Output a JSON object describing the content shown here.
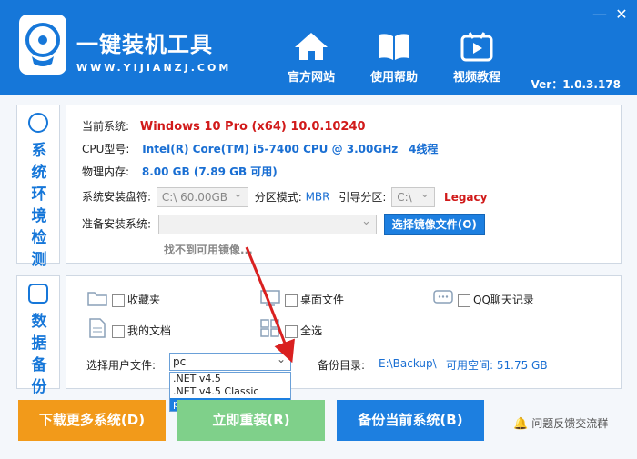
{
  "app": {
    "title": "一键装机工具",
    "url": "WWW.YIJIANZJ.COM",
    "version": "Ver：1.0.3.178",
    "minimize": "—",
    "close": "✕"
  },
  "nav": [
    {
      "label": "官方网站",
      "icon": "home-icon"
    },
    {
      "label": "使用帮助",
      "icon": "book-icon"
    },
    {
      "label": "视频教程",
      "icon": "video-icon"
    }
  ],
  "system": {
    "tab_label": "系统环境检测",
    "current_os_label": "当前系统:",
    "current_os_value": "Windows 10 Pro (x64) 10.0.10240",
    "cpu_label": "CPU型号:",
    "cpu_value": "Intel(R) Core(TM) i5-7400 CPU @ 3.00GHz",
    "cpu_threads": "4线程",
    "memory_label": "物理内存:",
    "memory_value": "8.00 GB (7.89 GB 可用)",
    "install_drive_label": "系统安装盘符:",
    "install_drive_value": "C:\\   60.00GB",
    "partition_label": "分区模式:",
    "partition_value": "MBR",
    "boot_label": "引导分区:",
    "boot_value": "C:\\",
    "boot_mode": "Legacy",
    "prepare_label": "准备安装系统:",
    "select_image_button": "选择镜像文件(O)",
    "no_image_text": "找不到可用镜像..."
  },
  "backup": {
    "tab_label": "数据备份",
    "items": [
      {
        "label": "收藏夹",
        "icon": "folder-icon"
      },
      {
        "label": "桌面文件",
        "icon": "desktop-icon"
      },
      {
        "label": "QQ聊天记录",
        "icon": "chat-icon"
      },
      {
        "label": "我的文档",
        "icon": "document-icon"
      },
      {
        "label": "全选",
        "icon": "grid-icon"
      }
    ],
    "user_file_label": "选择用户文件:",
    "user_file_value": "pc",
    "user_file_options": [
      ".NET v4.5",
      ".NET v4.5 Classic",
      "pc"
    ],
    "backup_dir_label": "备份目录:",
    "backup_dir_value": "E:\\Backup\\",
    "free_space": "可用空间: 51.75 GB"
  },
  "buttons": {
    "download_more": "下载更多系统(D)",
    "reinstall_now": "立即重装(R)",
    "backup_current": "备份当前系统(B)",
    "feedback": "问题反馈交流群"
  },
  "colors": {
    "header_blue": "#1677d9",
    "orange": "#f29a1a",
    "green": "#7fd08a",
    "blue_button": "#1d7fe0",
    "red_text": "#d11a1a"
  }
}
